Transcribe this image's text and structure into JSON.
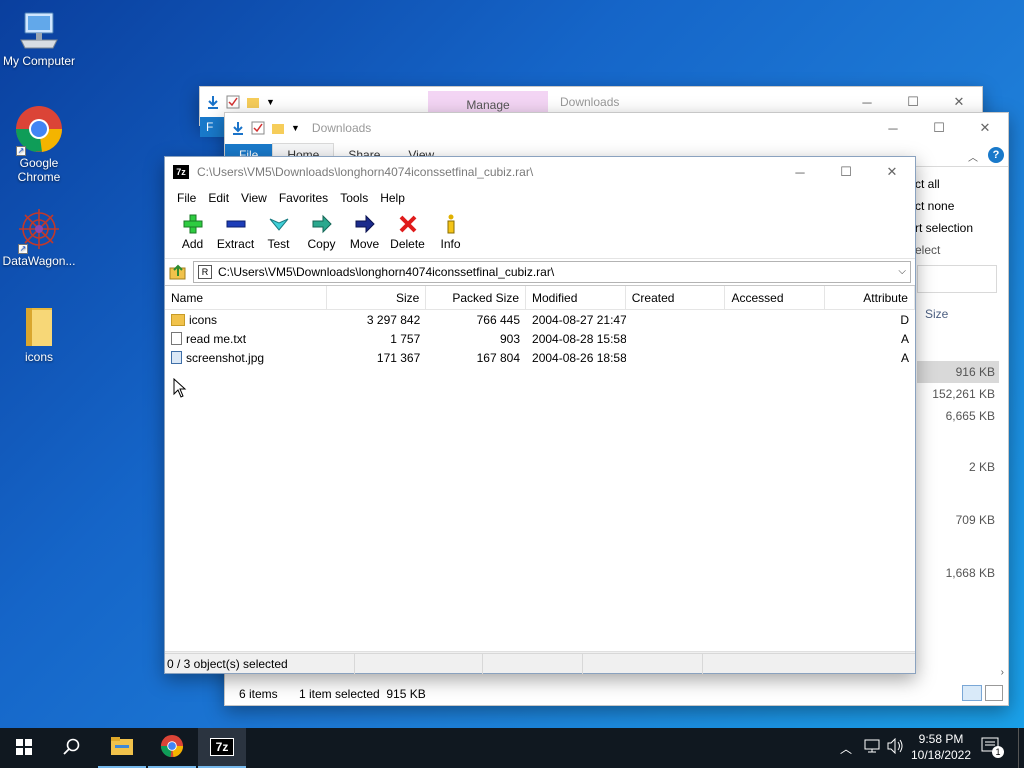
{
  "desktop": {
    "icons": [
      {
        "name": "my-computer",
        "label": "My Computer",
        "icon": "computer-icon"
      },
      {
        "name": "google-chrome",
        "label": "Google Chrome",
        "icon": "chrome-icon"
      },
      {
        "name": "datawagon",
        "label": "DataWagon...",
        "icon": "datawagon-icon"
      },
      {
        "name": "icons-folder",
        "label": "icons",
        "icon": "folder-icon"
      }
    ]
  },
  "explorer_back": {
    "title": "Downloads",
    "contextual_tab": "Manage",
    "tab_file": "F"
  },
  "explorer_front": {
    "title": "Downloads",
    "tabs": [
      "File",
      "Home",
      "Share",
      "View"
    ],
    "ribbon_select": [
      "ct all",
      "ct none",
      "rt selection",
      "elect"
    ],
    "size_header": "Size",
    "sizes": [
      "916 KB",
      "152,261 KB",
      "6,665 KB",
      "2 KB",
      "709 KB",
      "1,668 KB"
    ],
    "status_items": "6 items",
    "status_selected": "1 item selected  915 KB"
  },
  "zip": {
    "title": "C:\\Users\\VM5\\Downloads\\longhorn4074iconssetfinal_cubiz.rar\\",
    "menu": [
      "File",
      "Edit",
      "View",
      "Favorites",
      "Tools",
      "Help"
    ],
    "toolbar": [
      {
        "name": "add",
        "label": "Add",
        "icon": "add-icon"
      },
      {
        "name": "extract",
        "label": "Extract",
        "icon": "extract-icon"
      },
      {
        "name": "test",
        "label": "Test",
        "icon": "test-icon"
      },
      {
        "name": "copy",
        "label": "Copy",
        "icon": "copy-icon"
      },
      {
        "name": "move",
        "label": "Move",
        "icon": "move-icon"
      },
      {
        "name": "delete",
        "label": "Delete",
        "icon": "delete-icon"
      },
      {
        "name": "info",
        "label": "Info",
        "icon": "info-icon"
      }
    ],
    "address": "C:\\Users\\VM5\\Downloads\\longhorn4074iconssetfinal_cubiz.rar\\",
    "columns": [
      "Name",
      "Size",
      "Packed Size",
      "Modified",
      "Created",
      "Accessed",
      "Attribute"
    ],
    "rows": [
      {
        "name": "icons",
        "type": "folder-icon",
        "size": "3 297 842",
        "packed": "766 445",
        "modified": "2004-08-27 21:47",
        "attr": "D"
      },
      {
        "name": "read me.txt",
        "type": "text-file-icon",
        "size": "1 757",
        "packed": "903",
        "modified": "2004-08-28 15:58",
        "attr": "A"
      },
      {
        "name": "screenshot.jpg",
        "type": "image-file-icon",
        "size": "171 367",
        "packed": "167 804",
        "modified": "2004-08-26 18:58",
        "attr": "A"
      }
    ],
    "status": "0 / 3 object(s) selected"
  },
  "taskbar": {
    "time": "9:58 PM",
    "date": "10/18/2022",
    "notifications": "1",
    "apps": [
      "file-explorer-icon",
      "chrome-icon",
      "7zip-icon"
    ],
    "app_7z_label": "7z"
  },
  "colors": {
    "accent": "#1979ca",
    "manage_tab": "#f3d5f4",
    "taskbar": "#101820"
  }
}
